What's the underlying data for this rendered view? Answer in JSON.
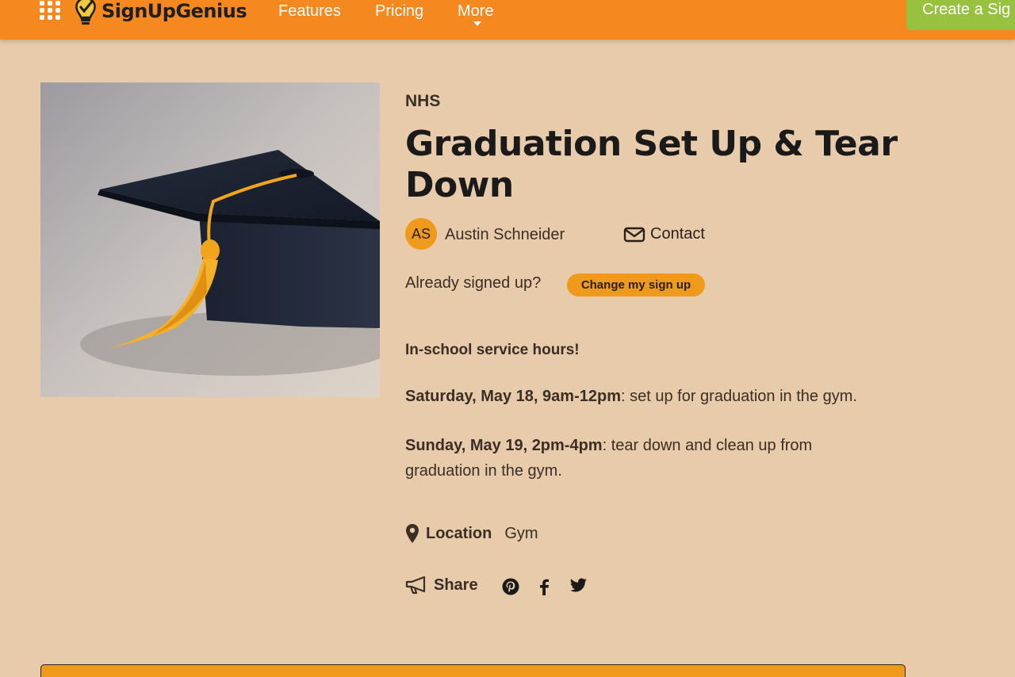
{
  "nav": {
    "logo_text": "SignUpGenius",
    "links": [
      "Features",
      "Pricing",
      "More"
    ],
    "create_label": "Create a Sig"
  },
  "hero": {
    "image_subject": "graduation cap with gold tassel"
  },
  "signup": {
    "group": "NHS",
    "title": "Graduation Set Up & Tear Down",
    "organizer_initials": "AS",
    "organizer_name": "Austin Schneider",
    "contact_label": "Contact",
    "already_signed_text": "Already signed up?",
    "change_button_label": "Change my sign up"
  },
  "description": {
    "intro": "In-school service hours!",
    "line1_bold": "Saturday, May 18, 9am-12pm",
    "line1_rest": ": set up for graduation in the gym.",
    "line2_bold": "Sunday, May 19, 2pm-4pm",
    "line2_rest": ": tear down and clean up from graduation in the gym."
  },
  "location": {
    "label": "Location",
    "value": "Gym"
  },
  "share": {
    "label": "Share",
    "networks": [
      "pinterest-icon",
      "facebook-icon",
      "twitter-icon"
    ]
  },
  "colors": {
    "nav_bg": "#f5891f",
    "page_bg": "#e8cbaa",
    "accent": "#ef9a1a",
    "create_btn": "#97c13f"
  }
}
